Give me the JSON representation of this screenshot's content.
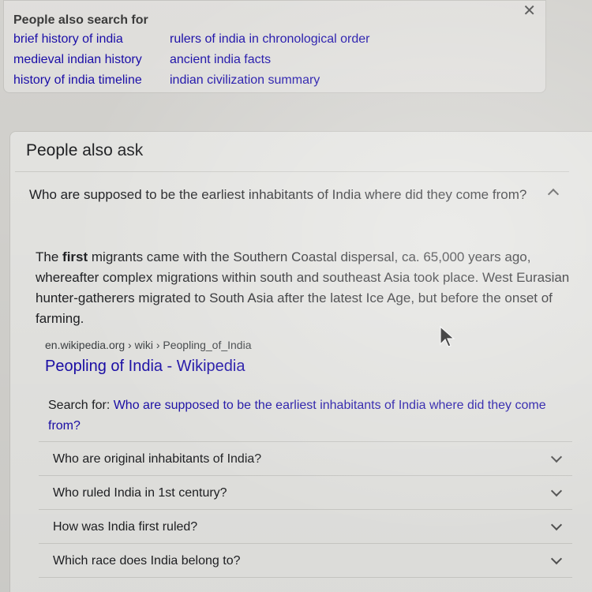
{
  "pasf": {
    "title": "People also search for",
    "links": [
      "brief history of india",
      "rulers of india in chronological order",
      "medieval indian history",
      "ancient india facts",
      "history of india timeline",
      "indian civilization summary"
    ]
  },
  "paa": {
    "title": "People also ask",
    "expanded_question": "Who are supposed to be the earliest inhabitants of India where did they come from?",
    "answer": {
      "pre": "The ",
      "bold": "first",
      "post": " migrants came with the Southern Coastal dispersal, ca. 65,000 years ago, whereafter complex migrations within south and southeast Asia took place. West Eurasian hunter-gatherers migrated to South Asia after the latest Ice Age, but before the onset of farming."
    },
    "source_url": "en.wikipedia.org › wiki › Peopling_of_India",
    "source_title": "Peopling of India - Wikipedia",
    "search_for_label": "Search for: ",
    "search_for_query": "Who are supposed to be the earliest inhabitants of India where did they come from?",
    "questions": [
      "Who are original inhabitants of India?",
      "Who ruled India in 1st century?",
      "How was India first ruled?",
      "Which race does India belong to?"
    ]
  },
  "icons": {
    "close": "close-icon",
    "chevron_up": "chevron-up-icon",
    "chevron_down": "chevron-down-icon",
    "cursor": "mouse-cursor-icon"
  }
}
